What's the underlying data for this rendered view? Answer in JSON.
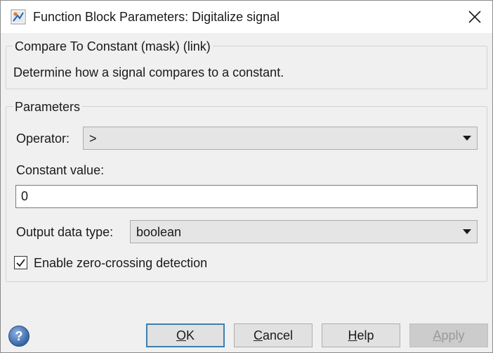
{
  "window": {
    "title": "Function Block Parameters: Digitalize signal",
    "icon": "simulink-block-icon",
    "close_icon": "close-icon"
  },
  "description_group": {
    "legend": "Compare To Constant (mask) (link)",
    "text": "Determine how a signal compares to a constant."
  },
  "parameters_group": {
    "legend": "Parameters",
    "operator": {
      "label": "Operator:",
      "value": ">"
    },
    "constant": {
      "label": "Constant value:",
      "value": "0"
    },
    "output_type": {
      "label": "Output data type:",
      "value": "boolean"
    },
    "zero_crossing": {
      "label": "Enable zero-crossing detection",
      "checked": true
    }
  },
  "buttons": {
    "ok": {
      "mnemonic": "O",
      "rest": "K",
      "label": "OK"
    },
    "cancel": {
      "mnemonic": "C",
      "rest": "ancel",
      "label": "Cancel"
    },
    "help": {
      "mnemonic": "H",
      "rest": "elp",
      "label": "Help"
    },
    "apply": {
      "mnemonic": "A",
      "rest": "pply",
      "label": "Apply",
      "enabled": false
    }
  },
  "colors": {
    "dialog_bg": "#f0f0f0",
    "default_button_border": "#3c7fb1",
    "help_icon": "#3a6fb5"
  }
}
